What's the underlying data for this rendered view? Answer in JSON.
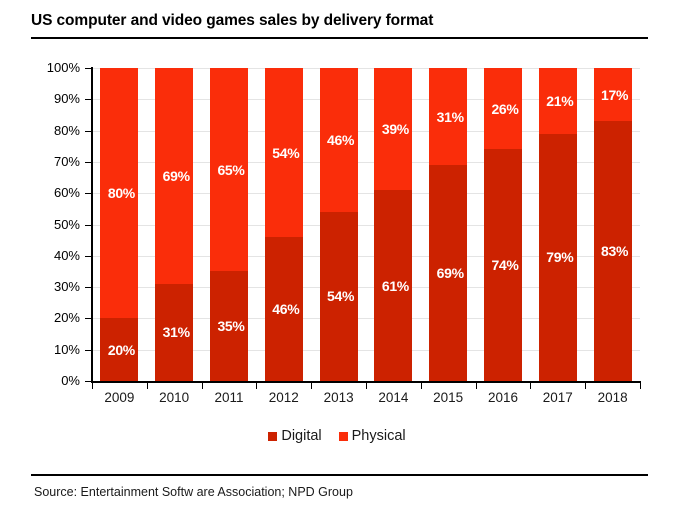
{
  "title": "US computer and video games sales by delivery format",
  "source": "Source: Entertainment Softw are Association; NPD Group",
  "legend": {
    "items": [
      {
        "label": "Digital",
        "color": "#cc2200"
      },
      {
        "label": "Physical",
        "color": "#fa2d0a"
      }
    ]
  },
  "axis": {
    "y_ticks": [
      "100%",
      "90%",
      "80%",
      "70%",
      "60%",
      "50%",
      "40%",
      "30%",
      "20%",
      "10%",
      "0%"
    ]
  },
  "chart_data": {
    "type": "bar",
    "subtype": "stacked-percent",
    "title": "US computer and video games sales by delivery format",
    "xlabel": "",
    "ylabel": "",
    "ylim": [
      0,
      100
    ],
    "ytick_step": 10,
    "grid": true,
    "legend_position": "bottom",
    "categories": [
      "2009",
      "2010",
      "2011",
      "2012",
      "2013",
      "2014",
      "2015",
      "2016",
      "2017",
      "2018"
    ],
    "series": [
      {
        "name": "Digital",
        "color": "#cc2200",
        "values": [
          20,
          31,
          35,
          46,
          54,
          61,
          69,
          74,
          79,
          83
        ],
        "labels": [
          "20%",
          "31%",
          "35%",
          "46%",
          "54%",
          "61%",
          "69%",
          "74%",
          "79%",
          "83%"
        ]
      },
      {
        "name": "Physical",
        "color": "#fa2d0a",
        "values": [
          80,
          69,
          65,
          54,
          46,
          39,
          31,
          26,
          21,
          17
        ],
        "labels": [
          "80%",
          "69%",
          "65%",
          "54%",
          "46%",
          "39%",
          "31%",
          "26%",
          "21%",
          "17%"
        ]
      }
    ]
  }
}
